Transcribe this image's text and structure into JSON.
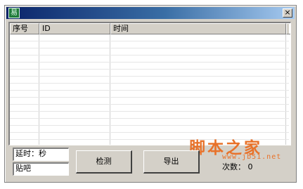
{
  "window": {
    "app_icon_glyph": "易",
    "close_glyph": "×"
  },
  "table": {
    "columns": [
      "序号",
      "ID",
      "时间"
    ]
  },
  "inputs": {
    "delay_value": "延时：秒",
    "tieba_value": "贴吧"
  },
  "buttons": {
    "detect_label": "检测",
    "export_label": "导出"
  },
  "status": {
    "count_text": "次数： 0"
  },
  "watermark": {
    "line1": "脚本之家",
    "line2": "www.jb51.net"
  },
  "colors": {
    "titlebar_start": "#0a246a",
    "titlebar_end": "#a6caf0",
    "window_face": "#d4d0c8",
    "watermark": "#e8722a"
  }
}
